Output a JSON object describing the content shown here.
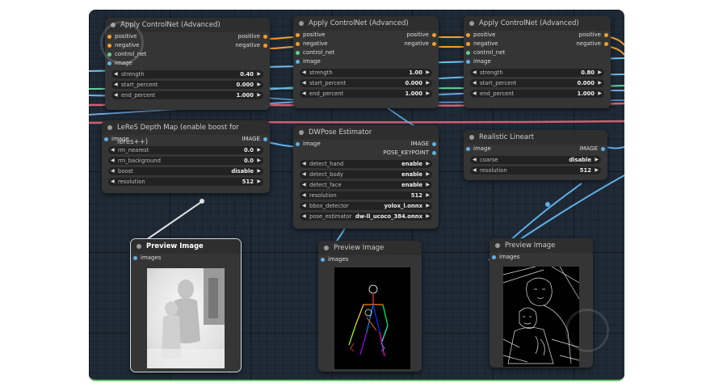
{
  "colors": {
    "conditioning": "#f0a030",
    "control_net": "#60d090",
    "image": "#60b0e8",
    "canvas": "#1f2a36",
    "node": "#353535"
  },
  "nodes": {
    "cn1": {
      "title": "Apply ControlNet (Advanced)",
      "in": [
        "positive",
        "negative",
        "control_net",
        "image"
      ],
      "out": [
        "positive",
        "negative"
      ],
      "widgets": [
        {
          "label": "strength",
          "value": "0.40"
        },
        {
          "label": "start_percent",
          "value": "0.000"
        },
        {
          "label": "end_percent",
          "value": "1.000"
        }
      ]
    },
    "cn2": {
      "title": "Apply ControlNet (Advanced)",
      "in": [
        "positive",
        "negative",
        "control_net",
        "image"
      ],
      "out": [
        "positive",
        "negative"
      ],
      "widgets": [
        {
          "label": "strength",
          "value": "1.00"
        },
        {
          "label": "start_percent",
          "value": "0.000"
        },
        {
          "label": "end_percent",
          "value": "1.000"
        }
      ]
    },
    "cn3": {
      "title": "Apply ControlNet (Advanced)",
      "in": [
        "positive",
        "negative",
        "control_net",
        "image"
      ],
      "out": [
        "positive",
        "negative"
      ],
      "widgets": [
        {
          "label": "strength",
          "value": "0.80"
        },
        {
          "label": "start_percent",
          "value": "0.000"
        },
        {
          "label": "end_percent",
          "value": "1.000"
        }
      ]
    },
    "leres": {
      "title": "LeReS Depth Map (enable boost for leres++)",
      "in": [
        "image"
      ],
      "out": [
        "IMAGE"
      ],
      "widgets": [
        {
          "label": "rm_nearest",
          "value": "0.0"
        },
        {
          "label": "rm_background",
          "value": "0.0"
        },
        {
          "label": "boost",
          "value": "disable"
        },
        {
          "label": "resolution",
          "value": "512"
        }
      ]
    },
    "dwpose": {
      "title": "DWPose Estimator",
      "in": [
        "image"
      ],
      "out": [
        "IMAGE",
        "POSE_KEYPOINT"
      ],
      "widgets": [
        {
          "label": "detect_hand",
          "value": "enable"
        },
        {
          "label": "detect_body",
          "value": "enable"
        },
        {
          "label": "detect_face",
          "value": "enable"
        },
        {
          "label": "resolution",
          "value": "512"
        },
        {
          "label": "bbox_detector",
          "value": "yolox_l.onnx"
        },
        {
          "label": "pose_estimator",
          "value": "dw-ll_ucoco_384.onnx"
        }
      ]
    },
    "lineart": {
      "title": "Realistic Lineart",
      "in": [
        "image"
      ],
      "out": [
        "IMAGE"
      ],
      "widgets": [
        {
          "label": "coarse",
          "value": "disable"
        },
        {
          "label": "resolution",
          "value": "512"
        }
      ]
    },
    "prev1": {
      "title": "Preview Image",
      "in": [
        "images"
      ]
    },
    "prev2": {
      "title": "Preview Image",
      "in": [
        "images"
      ]
    },
    "prev3": {
      "title": "Preview Image",
      "in": [
        "images"
      ]
    }
  }
}
